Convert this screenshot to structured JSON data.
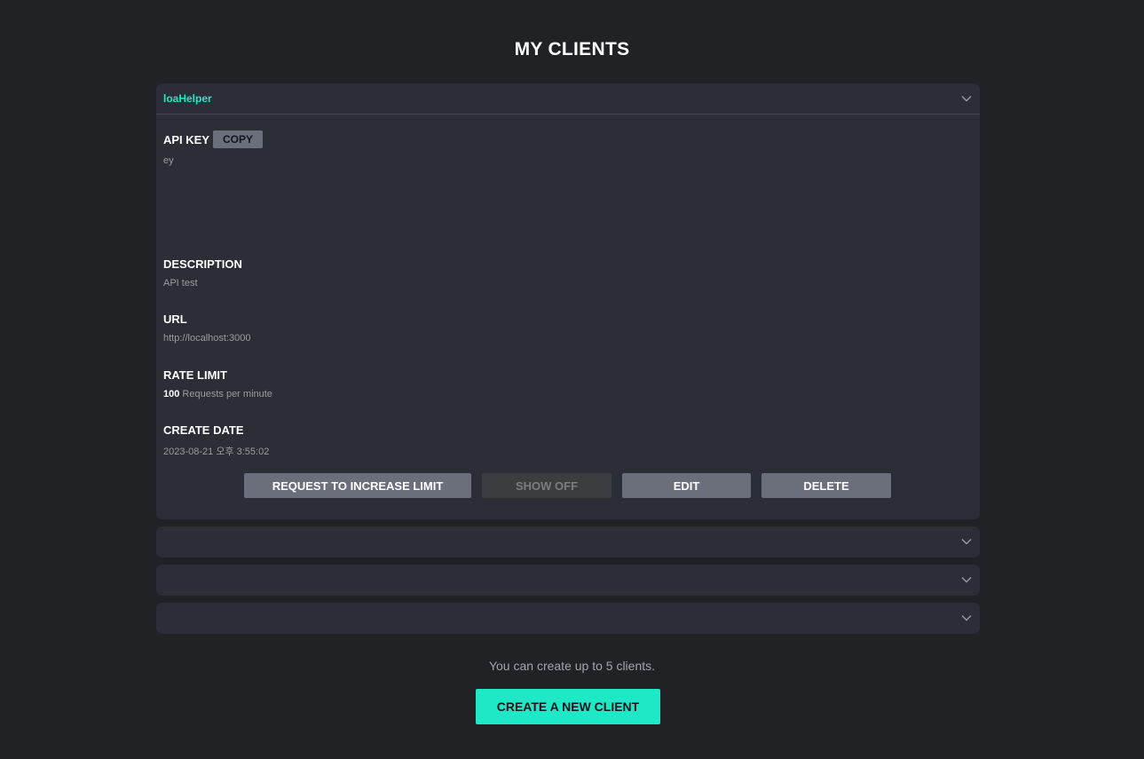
{
  "page": {
    "title": "MY CLIENTS"
  },
  "clients": [
    {
      "name": "loaHelper",
      "api_key_label": "API KEY",
      "copy_label": "COPY",
      "api_key_value": "ey",
      "description_label": "DESCRIPTION",
      "description_value": "API test",
      "url_label": "URL",
      "url_value": "http://localhost:3000",
      "rate_limit_label": "RATE LIMIT",
      "rate_limit_number": "100",
      "rate_limit_unit": "Requests per minute",
      "create_date_label": "CREATE DATE",
      "create_date_value": "2023-08-21 오후 3:55:02",
      "actions": {
        "request_limit": "REQUEST TO INCREASE LIMIT",
        "show_off": "SHOW OFF",
        "edit": "EDIT",
        "delete": "DELETE"
      },
      "expanded": true
    },
    {
      "name": "",
      "expanded": false
    },
    {
      "name": "",
      "expanded": false
    },
    {
      "name": "",
      "expanded": false
    }
  ],
  "footer": {
    "limit_note": "You can create up to 5 clients.",
    "create_label": "CREATE A NEW CLIENT"
  },
  "colors": {
    "background": "#212226",
    "panel": "#2b2e36",
    "accent": "#1ee8c6",
    "button": "#6b6f7c",
    "button_disabled": "#3c3d40"
  },
  "icons": {
    "expand": "chevron-down-icon"
  }
}
